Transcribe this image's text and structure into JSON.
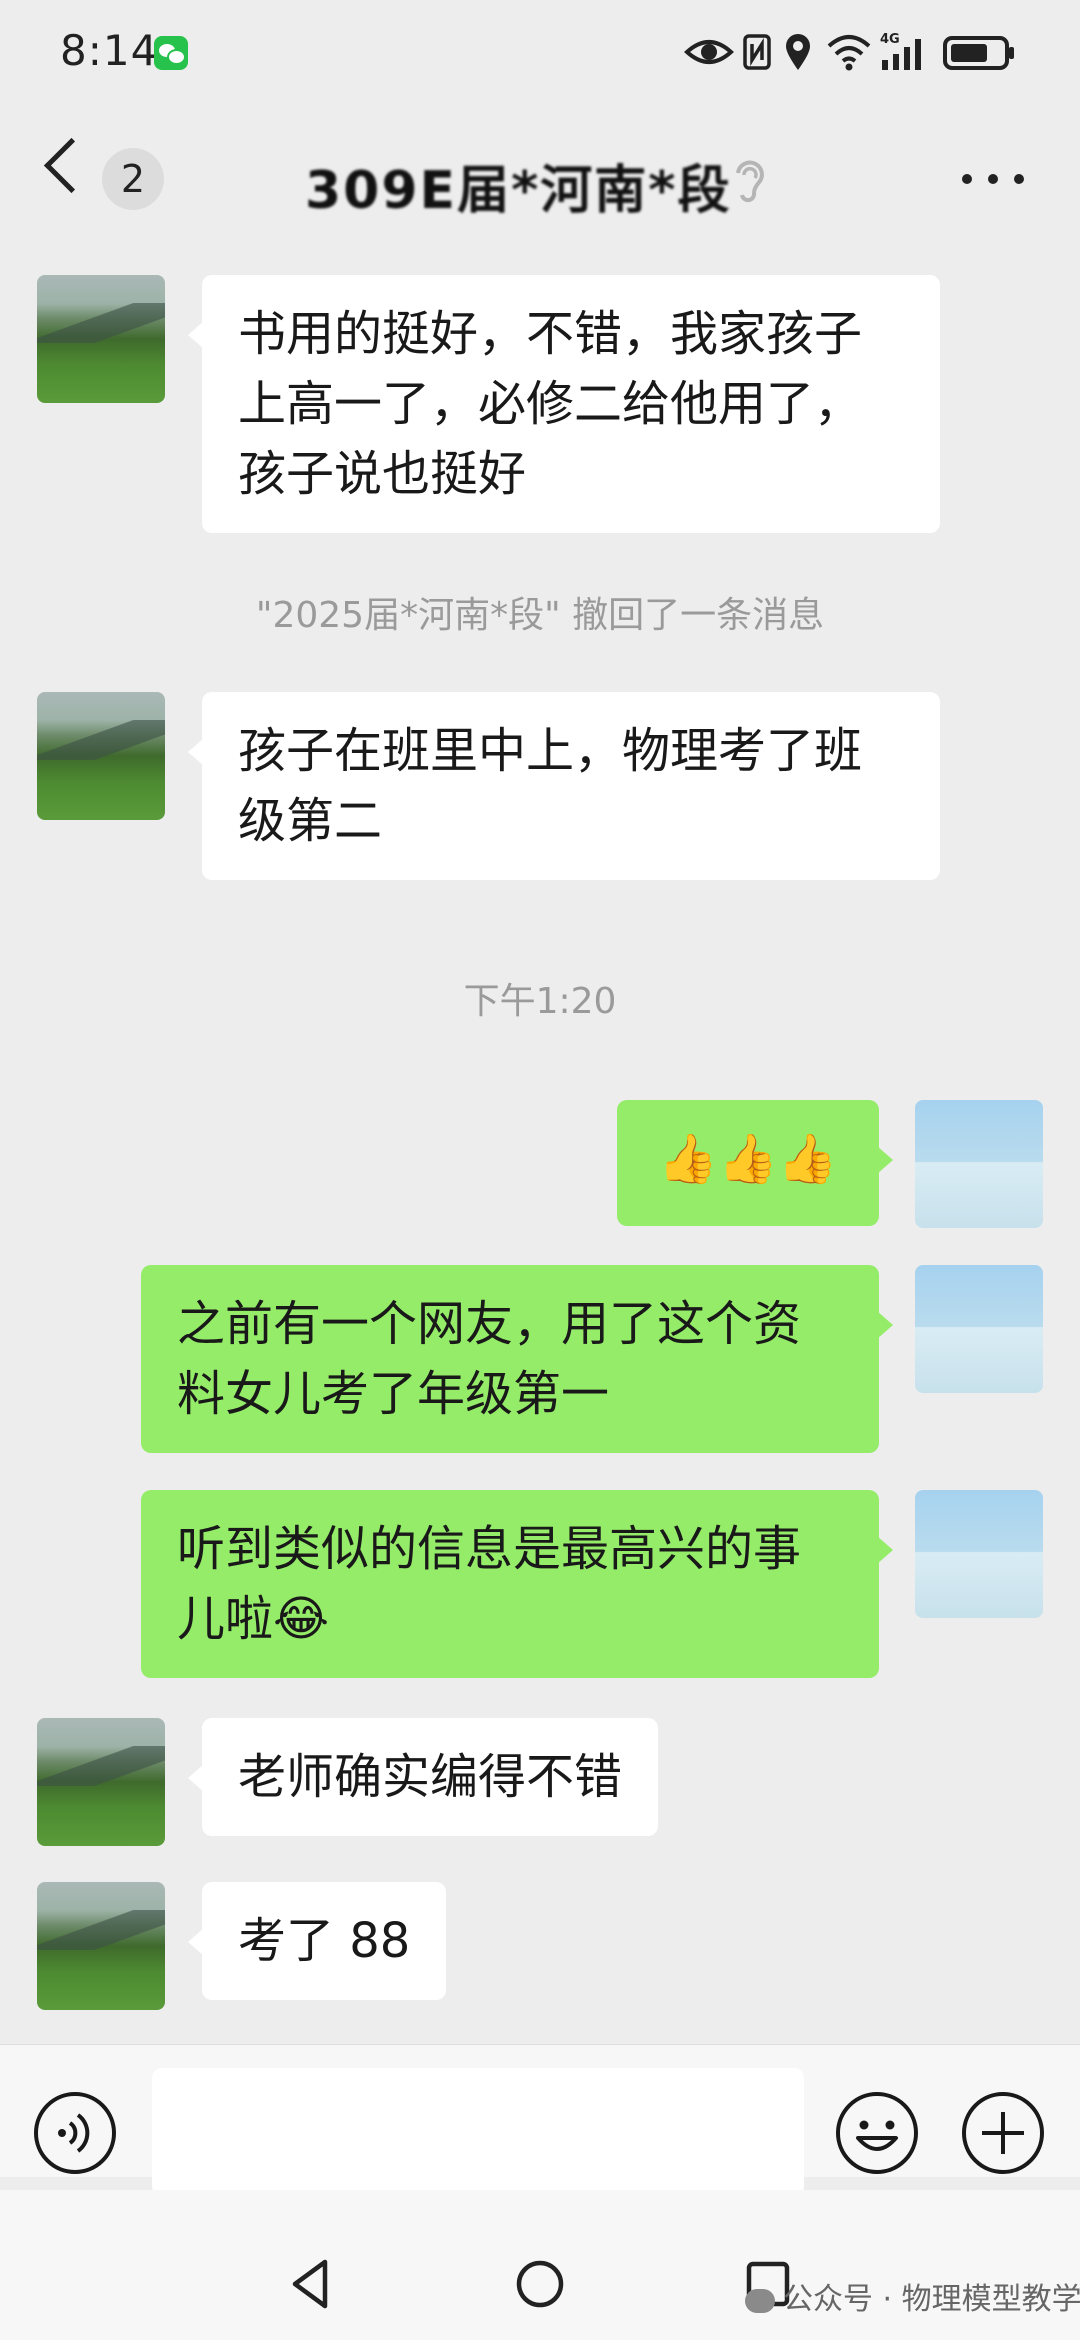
{
  "status_bar": {
    "time": "8:14",
    "icons": [
      "wechat-icon",
      "eye-icon",
      "nfc-icon",
      "location-icon",
      "wifi-icon",
      "4g-signal-icon",
      "battery-icon"
    ],
    "network_label": "4G"
  },
  "nav": {
    "back_icon": "back-arrow-icon",
    "unread_count": "2",
    "title": "309E届*河南*段",
    "ear_icon": "ear-icon",
    "more_icon": "more-dots-icon"
  },
  "messages": [
    {
      "side": "in",
      "text": "书用的挺好，不错，我家孩子上高一了，必修二给他用了，孩子说也挺好"
    },
    {
      "side": "system",
      "text": "\"2025届*河南*段\" 撤回了一条消息"
    },
    {
      "side": "in",
      "text": "孩子在班里中上，物理考了班级第二"
    },
    {
      "side": "timestamp",
      "text": "下午1:20"
    },
    {
      "side": "out",
      "text": "👍👍👍"
    },
    {
      "side": "out",
      "text": "之前有一个网友，用了这个资料女儿考了年级第一"
    },
    {
      "side": "out",
      "text": "听到类似的信息是最高兴的事儿啦😂"
    },
    {
      "side": "in",
      "text": "老师确实编得不错"
    },
    {
      "side": "in",
      "text": "考了 88"
    }
  ],
  "input_bar": {
    "voice_icon": "voice-mode-icon",
    "input_value": "",
    "emoji_icon": "emoji-icon",
    "plus_icon": "plus-icon"
  },
  "bottom_nav": {
    "icons": [
      "nav-back-icon",
      "nav-home-icon",
      "nav-recents-icon"
    ],
    "watermark": "公众号 · 物理模型教学"
  },
  "colors": {
    "background": "#ededed",
    "incoming_bubble": "#ffffff",
    "outgoing_bubble": "#95ec69",
    "system_text": "#9a9a9a"
  }
}
